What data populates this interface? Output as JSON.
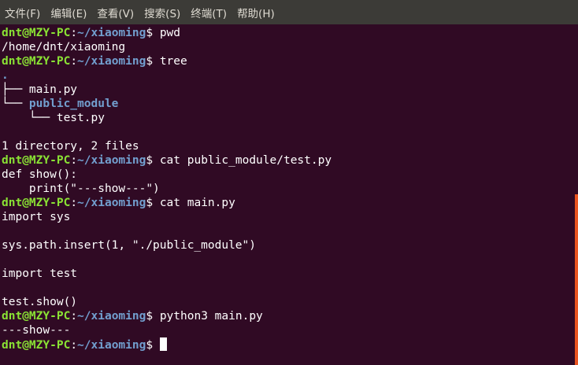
{
  "menu": [
    "文件(F)",
    "编辑(E)",
    "查看(V)",
    "搜索(S)",
    "终端(T)",
    "帮助(H)"
  ],
  "prompt": {
    "user_host": "dnt@MZY-PC",
    "sep": ":",
    "path": "~/xiaoming",
    "symbol": "$ "
  },
  "lines": [
    {
      "kind": "prompt",
      "cmd": "pwd"
    },
    {
      "kind": "out",
      "text": "/home/dnt/xiaoming"
    },
    {
      "kind": "prompt",
      "cmd": "tree"
    },
    {
      "kind": "out",
      "text": ".",
      "style": "dir"
    },
    {
      "kind": "out",
      "text": "├── main.py"
    },
    {
      "kind": "tree-dir",
      "prefix": "└── ",
      "text": "public_module"
    },
    {
      "kind": "out",
      "text": "    └── test.py"
    },
    {
      "kind": "out",
      "text": ""
    },
    {
      "kind": "out",
      "text": "1 directory, 2 files"
    },
    {
      "kind": "prompt",
      "cmd": "cat public_module/test.py"
    },
    {
      "kind": "out",
      "text": "def show():"
    },
    {
      "kind": "out",
      "text": "    print(\"---show---\")"
    },
    {
      "kind": "prompt",
      "cmd": "cat main.py"
    },
    {
      "kind": "out",
      "text": "import sys"
    },
    {
      "kind": "out",
      "text": ""
    },
    {
      "kind": "out",
      "text": "sys.path.insert(1, \"./public_module\")"
    },
    {
      "kind": "out",
      "text": ""
    },
    {
      "kind": "out",
      "text": "import test"
    },
    {
      "kind": "out",
      "text": ""
    },
    {
      "kind": "out",
      "text": "test.show()"
    },
    {
      "kind": "prompt",
      "cmd": "python3 main.py"
    },
    {
      "kind": "out",
      "text": "---show---"
    },
    {
      "kind": "prompt",
      "cmd": "",
      "cursor": true
    }
  ],
  "colors": {
    "background": "#300a24",
    "user": "#8ae234",
    "path": "#729fcf",
    "scroll": "#e95420"
  }
}
